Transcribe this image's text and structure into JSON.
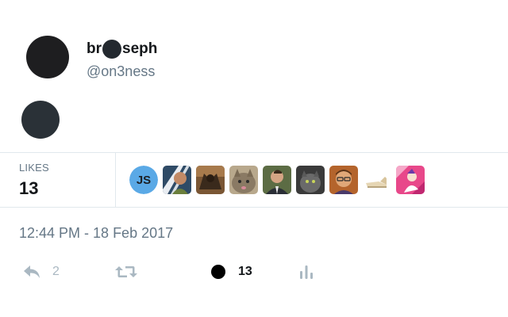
{
  "user": {
    "name_prefix": "br",
    "name_suffix": "seph",
    "handle": "@on3ness"
  },
  "stats": {
    "likes_label": "LIKES",
    "likes_count": "13",
    "liker_avatars": [
      {
        "name": "js-avatar",
        "text": "JS",
        "color": "#5aa9e6"
      },
      {
        "name": "striped-man-avatar",
        "color": "#3c5a7a"
      },
      {
        "name": "bat-figure-avatar",
        "color": "#6b4a2e"
      },
      {
        "name": "cat-avatar",
        "color": "#9c8c74"
      },
      {
        "name": "man-suit-avatar",
        "color": "#4c5c3c"
      },
      {
        "name": "dark-cat-avatar",
        "color": "#505050"
      },
      {
        "name": "glasses-man-avatar",
        "color": "#a0582c"
      },
      {
        "name": "shoe-avatar",
        "color": "#e8dcc4"
      },
      {
        "name": "pink-illustration-avatar",
        "color": "#e0508c"
      }
    ]
  },
  "timestamp": "12:44 PM - 18 Feb 2017",
  "actions": {
    "reply_count": "2",
    "retweet_count": "",
    "like_count": "13"
  },
  "colors": {
    "muted": "#657786",
    "icon": "#aab8c2",
    "border": "#e1e8ed"
  }
}
